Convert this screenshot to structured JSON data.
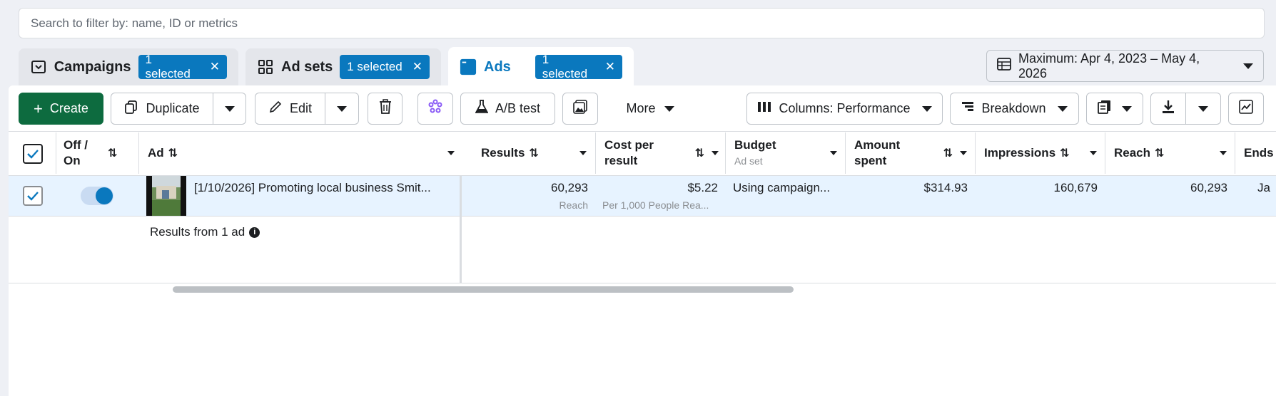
{
  "search": {
    "placeholder": "Search to filter by: name, ID or metrics"
  },
  "tabs": [
    {
      "label": "Campaigns",
      "selected": "1 selected",
      "icon": "campaign-icon"
    },
    {
      "label": "Ad sets",
      "selected": "1 selected",
      "icon": "grid-icon"
    },
    {
      "label": "Ads",
      "selected": "1 selected",
      "icon": "ad-icon"
    }
  ],
  "date_range": {
    "label": "Maximum: Apr 4, 2023 – May 4, 2026"
  },
  "toolbar": {
    "create": "Create",
    "duplicate": "Duplicate",
    "edit": "Edit",
    "ab_test": "A/B test",
    "more": "More",
    "columns": "Columns: Performance",
    "breakdown": "Breakdown"
  },
  "table": {
    "columns": {
      "off_on": "Off / On",
      "ad": "Ad",
      "results": "Results",
      "cost_per_result": "Cost per result",
      "budget": "Budget",
      "budget_sub": "Ad set",
      "amount_spent": "Amount spent",
      "impressions": "Impressions",
      "reach": "Reach",
      "ends": "Ends"
    },
    "row": {
      "ad_name": "[1/10/2026] Promoting local business Smit...",
      "results": "60,293",
      "results_sub": "Reach",
      "cost_per_result": "$5.22",
      "cost_sub": "Per 1,000 People Rea...",
      "budget": "Using campaign...",
      "amount_spent": "$314.93",
      "impressions": "160,679",
      "reach": "60,293",
      "ends": "Ja"
    },
    "summary": "Results from 1 ad"
  },
  "colors": {
    "accent": "#0a78be",
    "create": "#0d6b3f",
    "row_selected": "#e7f3ff"
  }
}
